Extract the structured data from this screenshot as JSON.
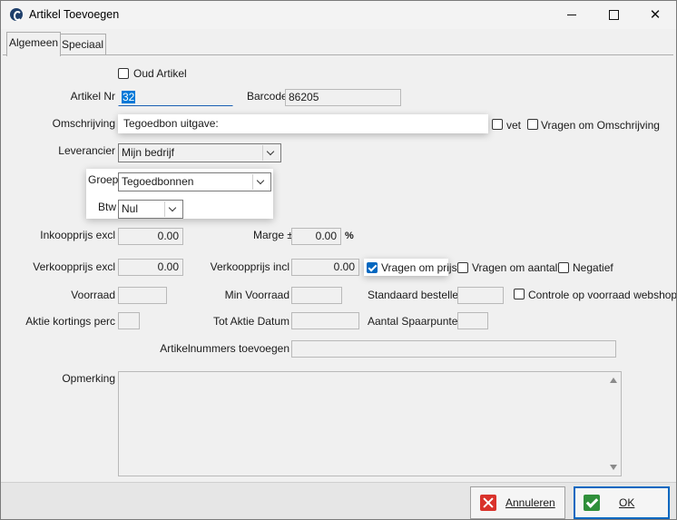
{
  "window": {
    "title": "Artikel Toevoegen",
    "icon": "app-logo-icon",
    "minimize_icon": "minimize-icon",
    "maximize_icon": "maximize-icon",
    "close_icon": "close-icon",
    "close_glyph": "✕"
  },
  "tabs": [
    {
      "label": "Algemeen"
    },
    {
      "label": "Speciaal"
    }
  ],
  "form": {
    "oud_artikel_label": "Oud Artikel",
    "artikel_nr_label": "Artikel Nr",
    "artikel_nr_value": "32",
    "barcode_label": "Barcode",
    "barcode_value": "86205",
    "omschrijving_label": "Omschrijving",
    "omschrijving_value": "Tegoedbon uitgave:",
    "vet_label": "vet",
    "vragen_om_omschrijving_label": "Vragen om Omschrijving",
    "leverancier_label": "Leverancier",
    "leverancier_value": "Mijn bedrijf",
    "groep_label": "Groep",
    "groep_value": "Tegoedbonnen",
    "btw_label": "Btw",
    "btw_value": "Nul",
    "inkoopprijs_label": "Inkoopprijs excl",
    "inkoopprijs_value": "0.00",
    "marge_label": "Marge ±",
    "marge_value": "0.00",
    "marge_unit": "%",
    "verkoopprijs_excl_label": "Verkoopprijs excl",
    "verkoopprijs_excl_value": "0.00",
    "verkoopprijs_incl_label": "Verkoopprijs incl",
    "verkoopprijs_incl_value": "0.00",
    "vragen_om_prijs_label": "Vragen om prijs",
    "vragen_om_aantal_label": "Vragen om aantal",
    "negatief_label": "Negatief",
    "voorraad_label": "Voorraad",
    "min_voorraad_label": "Min Voorraad",
    "standaard_bestellen_label": "Standaard bestellen",
    "controle_voorraad_label": "Controle op voorraad webshop",
    "aktie_kortings_label": "Aktie kortings perc",
    "tot_aktie_datum_label": "Tot Aktie Datum",
    "aantal_spaarpunten_label": "Aantal Spaarpunten",
    "artikelnummers_toevoegen_label": "Artikelnummers toevoegen",
    "opmerking_label": "Opmerking"
  },
  "checkboxes": {
    "oud_artikel": false,
    "vet": false,
    "vragen_om_omschrijving": false,
    "vragen_om_prijs": true,
    "vragen_om_aantal": false,
    "negatief": false,
    "controle_voorraad": false
  },
  "buttons": {
    "annuleren_label": "Annuleren",
    "ok_label": "OK"
  },
  "colors": {
    "accent": "#0067c0",
    "cancel_icon": "#d9322b",
    "ok_icon": "#2f8f3a"
  }
}
